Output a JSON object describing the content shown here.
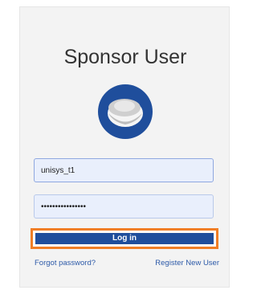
{
  "page": {
    "title": "Sponsor User"
  },
  "logo": {
    "icon": "unisys-logo-icon",
    "colors": {
      "ring": "#1f4e9c",
      "disc": "#d9d9d9"
    }
  },
  "form": {
    "username_value": "unisys_t1",
    "password_value": "••••••••••••••••",
    "login_label": "Log in"
  },
  "links": {
    "forgot": "Forgot password?",
    "register": "Register New User"
  },
  "colors": {
    "accent": "#1f4e9c",
    "highlight": "#f07e26"
  }
}
